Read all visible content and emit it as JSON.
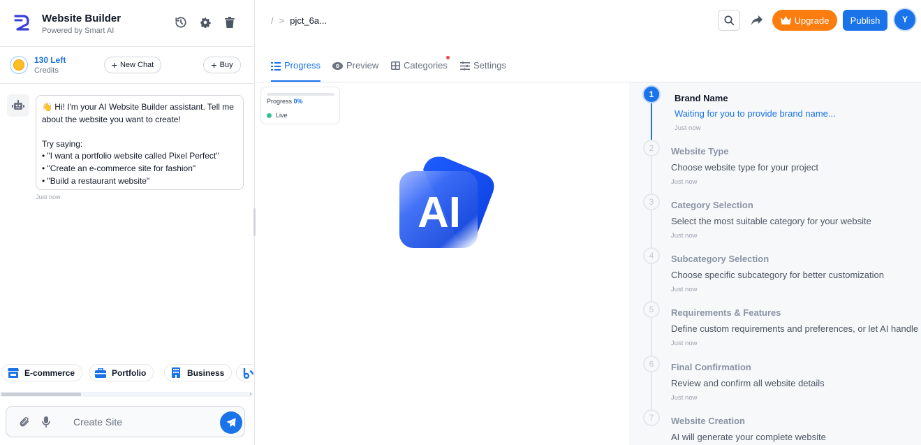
{
  "app": {
    "title": "Website Builder",
    "subtitle": "Powered by Smart AI"
  },
  "credits": {
    "amount": "130 Left",
    "label": "Credits",
    "new_chat_label": "New Chat",
    "buy_label": "Buy"
  },
  "chat": {
    "message_lines": [
      "Hi! I'm your AI Website Builder assistant. Tell me",
      "about the website you want to create!",
      "Try saying:",
      "• \"I want a portfolio website called Pixel Perfect\"",
      "• \"Create an e-commerce site for fashion\"",
      "• \"Build a restaurant website\""
    ],
    "timestamp": "Just now",
    "emoji": "👋"
  },
  "quick_actions": [
    {
      "label": "E-commerce",
      "icon": "store-icon"
    },
    {
      "label": "Portfolio",
      "icon": "briefcase-icon"
    },
    {
      "label": "Business",
      "icon": "building-icon"
    }
  ],
  "composer": {
    "placeholder": "Create Site"
  },
  "header": {
    "breadcrumb_root": "/",
    "breadcrumb_sep": ">",
    "project": "pjct_6a...",
    "upgrade_label": "Upgrade",
    "publish_label": "Publish",
    "user_initial": "Y"
  },
  "tabs": [
    {
      "label": "Progress",
      "icon": "list-icon",
      "active": true
    },
    {
      "label": "Preview",
      "icon": "eye-icon",
      "active": false
    },
    {
      "label": "Categories",
      "icon": "grid-icon",
      "active": false
    },
    {
      "label": "Settings",
      "icon": "sliders-icon",
      "active": false
    }
  ],
  "progress_card": {
    "label": "Progress",
    "percent": "0%",
    "status": "Live"
  },
  "logo_text": "AI",
  "steps": [
    {
      "num": "1",
      "title": "Brand Name",
      "desc": "Waiting for you to provide brand name...",
      "time": "Just now",
      "active": true
    },
    {
      "num": "2",
      "title": "Website Type",
      "desc": "Choose website type for your project",
      "time": "Just now",
      "active": false
    },
    {
      "num": "3",
      "title": "Category Selection",
      "desc": "Select the most suitable category for your website",
      "time": "Just now",
      "active": false
    },
    {
      "num": "4",
      "title": "Subcategory Selection",
      "desc": "Choose specific subcategory for better customization",
      "time": "Just now",
      "active": false
    },
    {
      "num": "5",
      "title": "Requirements & Features",
      "desc": "Define custom requirements and preferences, or let AI handle it.",
      "time": "Just now",
      "active": false
    },
    {
      "num": "6",
      "title": "Final Confirmation",
      "desc": "Review and confirm all website details",
      "time": "Just now",
      "active": false
    },
    {
      "num": "7",
      "title": "Website Creation",
      "desc": "AI will generate your complete website",
      "time": "",
      "active": false
    }
  ],
  "colors": {
    "accent": "#1a73e8",
    "upgrade": "#fb7c0f",
    "live": "#34c38f"
  }
}
